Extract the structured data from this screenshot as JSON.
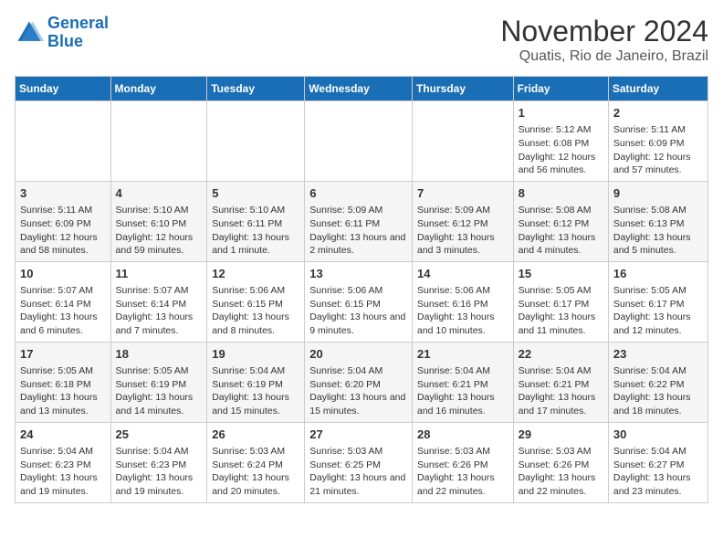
{
  "header": {
    "logo_line1": "General",
    "logo_line2": "Blue",
    "title": "November 2024",
    "subtitle": "Quatis, Rio de Janeiro, Brazil"
  },
  "days_of_week": [
    "Sunday",
    "Monday",
    "Tuesday",
    "Wednesday",
    "Thursday",
    "Friday",
    "Saturday"
  ],
  "weeks": [
    [
      {
        "day": "",
        "info": ""
      },
      {
        "day": "",
        "info": ""
      },
      {
        "day": "",
        "info": ""
      },
      {
        "day": "",
        "info": ""
      },
      {
        "day": "",
        "info": ""
      },
      {
        "day": "1",
        "info": "Sunrise: 5:12 AM\nSunset: 6:08 PM\nDaylight: 12 hours and 56 minutes."
      },
      {
        "day": "2",
        "info": "Sunrise: 5:11 AM\nSunset: 6:09 PM\nDaylight: 12 hours and 57 minutes."
      }
    ],
    [
      {
        "day": "3",
        "info": "Sunrise: 5:11 AM\nSunset: 6:09 PM\nDaylight: 12 hours and 58 minutes."
      },
      {
        "day": "4",
        "info": "Sunrise: 5:10 AM\nSunset: 6:10 PM\nDaylight: 12 hours and 59 minutes."
      },
      {
        "day": "5",
        "info": "Sunrise: 5:10 AM\nSunset: 6:11 PM\nDaylight: 13 hours and 1 minute."
      },
      {
        "day": "6",
        "info": "Sunrise: 5:09 AM\nSunset: 6:11 PM\nDaylight: 13 hours and 2 minutes."
      },
      {
        "day": "7",
        "info": "Sunrise: 5:09 AM\nSunset: 6:12 PM\nDaylight: 13 hours and 3 minutes."
      },
      {
        "day": "8",
        "info": "Sunrise: 5:08 AM\nSunset: 6:12 PM\nDaylight: 13 hours and 4 minutes."
      },
      {
        "day": "9",
        "info": "Sunrise: 5:08 AM\nSunset: 6:13 PM\nDaylight: 13 hours and 5 minutes."
      }
    ],
    [
      {
        "day": "10",
        "info": "Sunrise: 5:07 AM\nSunset: 6:14 PM\nDaylight: 13 hours and 6 minutes."
      },
      {
        "day": "11",
        "info": "Sunrise: 5:07 AM\nSunset: 6:14 PM\nDaylight: 13 hours and 7 minutes."
      },
      {
        "day": "12",
        "info": "Sunrise: 5:06 AM\nSunset: 6:15 PM\nDaylight: 13 hours and 8 minutes."
      },
      {
        "day": "13",
        "info": "Sunrise: 5:06 AM\nSunset: 6:15 PM\nDaylight: 13 hours and 9 minutes."
      },
      {
        "day": "14",
        "info": "Sunrise: 5:06 AM\nSunset: 6:16 PM\nDaylight: 13 hours and 10 minutes."
      },
      {
        "day": "15",
        "info": "Sunrise: 5:05 AM\nSunset: 6:17 PM\nDaylight: 13 hours and 11 minutes."
      },
      {
        "day": "16",
        "info": "Sunrise: 5:05 AM\nSunset: 6:17 PM\nDaylight: 13 hours and 12 minutes."
      }
    ],
    [
      {
        "day": "17",
        "info": "Sunrise: 5:05 AM\nSunset: 6:18 PM\nDaylight: 13 hours and 13 minutes."
      },
      {
        "day": "18",
        "info": "Sunrise: 5:05 AM\nSunset: 6:19 PM\nDaylight: 13 hours and 14 minutes."
      },
      {
        "day": "19",
        "info": "Sunrise: 5:04 AM\nSunset: 6:19 PM\nDaylight: 13 hours and 15 minutes."
      },
      {
        "day": "20",
        "info": "Sunrise: 5:04 AM\nSunset: 6:20 PM\nDaylight: 13 hours and 15 minutes."
      },
      {
        "day": "21",
        "info": "Sunrise: 5:04 AM\nSunset: 6:21 PM\nDaylight: 13 hours and 16 minutes."
      },
      {
        "day": "22",
        "info": "Sunrise: 5:04 AM\nSunset: 6:21 PM\nDaylight: 13 hours and 17 minutes."
      },
      {
        "day": "23",
        "info": "Sunrise: 5:04 AM\nSunset: 6:22 PM\nDaylight: 13 hours and 18 minutes."
      }
    ],
    [
      {
        "day": "24",
        "info": "Sunrise: 5:04 AM\nSunset: 6:23 PM\nDaylight: 13 hours and 19 minutes."
      },
      {
        "day": "25",
        "info": "Sunrise: 5:04 AM\nSunset: 6:23 PM\nDaylight: 13 hours and 19 minutes."
      },
      {
        "day": "26",
        "info": "Sunrise: 5:03 AM\nSunset: 6:24 PM\nDaylight: 13 hours and 20 minutes."
      },
      {
        "day": "27",
        "info": "Sunrise: 5:03 AM\nSunset: 6:25 PM\nDaylight: 13 hours and 21 minutes."
      },
      {
        "day": "28",
        "info": "Sunrise: 5:03 AM\nSunset: 6:26 PM\nDaylight: 13 hours and 22 minutes."
      },
      {
        "day": "29",
        "info": "Sunrise: 5:03 AM\nSunset: 6:26 PM\nDaylight: 13 hours and 22 minutes."
      },
      {
        "day": "30",
        "info": "Sunrise: 5:04 AM\nSunset: 6:27 PM\nDaylight: 13 hours and 23 minutes."
      }
    ]
  ]
}
